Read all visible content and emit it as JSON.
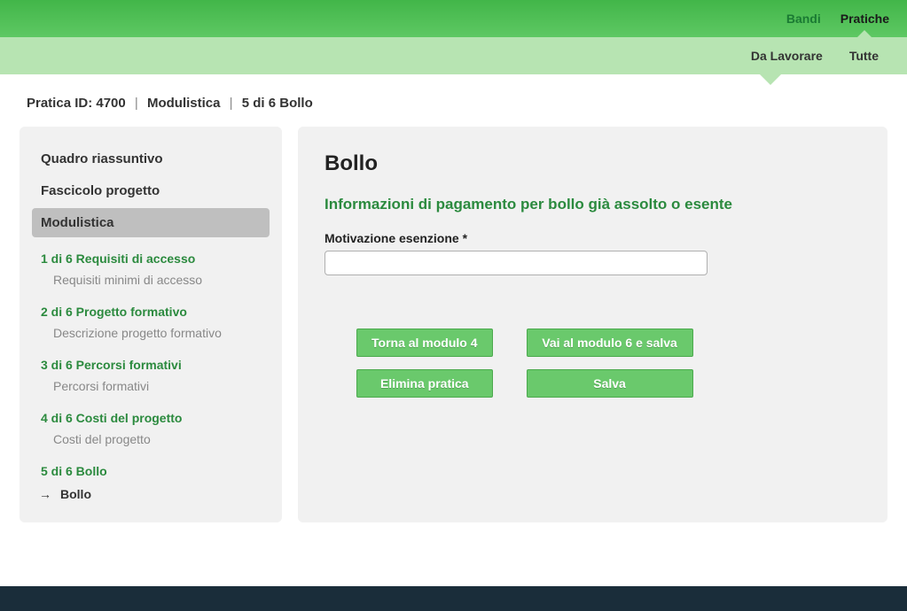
{
  "topNav": {
    "bandi": "Bandi",
    "pratiche": "Pratiche"
  },
  "subNav": {
    "daLavorare": "Da Lavorare",
    "tutte": "Tutte"
  },
  "breadcrumb": {
    "praticaId": "Pratica ID: 4700",
    "modulistica": "Modulistica",
    "step": "5 di 6 Bollo"
  },
  "sidebar": {
    "quadro": "Quadro riassuntivo",
    "fascicolo": "Fascicolo progetto",
    "modulistica": "Modulistica",
    "modules": [
      {
        "title": "1 di 6 Requisiti di accesso",
        "sub": "Requisiti minimi di accesso"
      },
      {
        "title": "2 di 6 Progetto formativo",
        "sub": "Descrizione progetto formativo"
      },
      {
        "title": "3 di 6 Percorsi formativi",
        "sub": "Percorsi formativi"
      },
      {
        "title": "4 di 6 Costi del progetto",
        "sub": "Costi del progetto"
      },
      {
        "title": "5 di 6 Bollo",
        "sub": "Bollo"
      }
    ]
  },
  "main": {
    "title": "Bollo",
    "sectionTitle": "Informazioni di pagamento per bollo già assolto o esente",
    "fieldLabel": "Motivazione esenzione *",
    "buttons": {
      "back": "Torna al modulo 4",
      "next": "Vai al modulo 6 e salva",
      "delete": "Elimina pratica",
      "save": "Salva"
    }
  }
}
